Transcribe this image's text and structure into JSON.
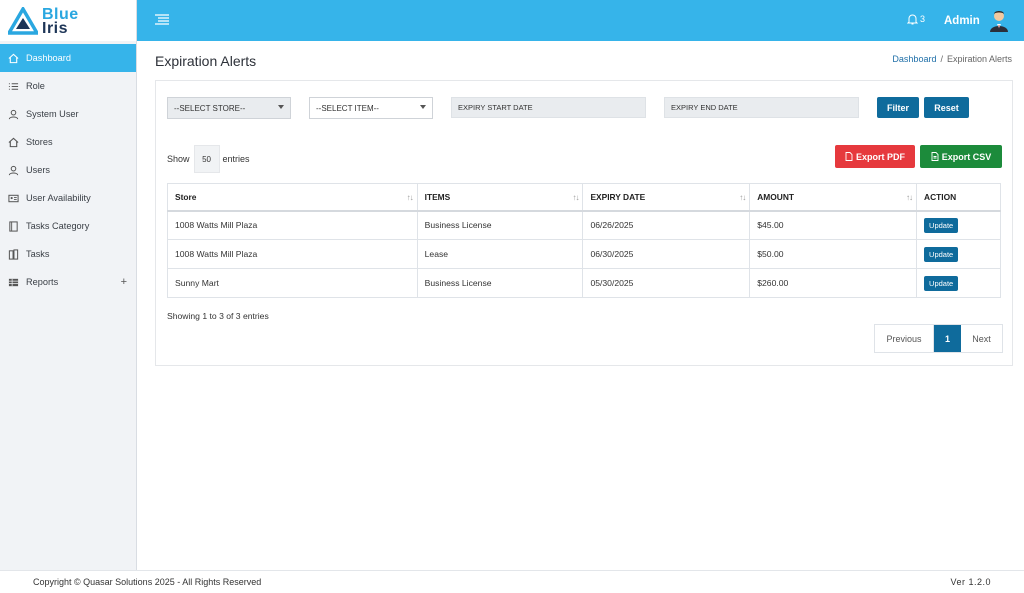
{
  "brand": {
    "line1": "Blue",
    "line2": "Iris"
  },
  "sidebar": {
    "items": [
      {
        "label": "Dashboard",
        "icon": "home-icon"
      },
      {
        "label": "Role",
        "icon": "list-icon"
      },
      {
        "label": "System User",
        "icon": "user-icon"
      },
      {
        "label": "Stores",
        "icon": "home-icon"
      },
      {
        "label": "Users",
        "icon": "user-icon"
      },
      {
        "label": "User Availability",
        "icon": "id-card-icon"
      },
      {
        "label": "Tasks Category",
        "icon": "book-icon"
      },
      {
        "label": "Tasks",
        "icon": "books-icon"
      },
      {
        "label": "Reports",
        "icon": "table-icon",
        "expand": "+"
      }
    ]
  },
  "header": {
    "notification_count": "3",
    "user_name": "Admin"
  },
  "page": {
    "title": "Expiration Alerts",
    "breadcrumb": {
      "home": "Dashboard",
      "separator": "/",
      "current": "Expiration Alerts"
    }
  },
  "filters": {
    "store_select": "--SELECT STORE--",
    "item_select": "--SELECT ITEM--",
    "start_date_placeholder": "EXPIRY START DATE",
    "end_date_placeholder": "EXPIRY END DATE",
    "filter_label": "Filter",
    "reset_label": "Reset"
  },
  "export": {
    "pdf_label": "Export PDF",
    "csv_label": "Export CSV"
  },
  "entries": {
    "show_label": "Show",
    "value": "50",
    "suffix": "entries"
  },
  "table": {
    "headers": [
      "Store",
      "ITEMS",
      "EXPIRY DATE",
      "AMOUNT",
      "ACTION"
    ],
    "rows": [
      {
        "store": "1008 Watts Mill Plaza",
        "item": "Business License",
        "date": "06/26/2025",
        "amount": "$45.00",
        "action": "Update"
      },
      {
        "store": "1008 Watts Mill Plaza",
        "item": "Lease",
        "date": "06/30/2025",
        "amount": "$50.00",
        "action": "Update"
      },
      {
        "store": "Sunny Mart",
        "item": "Business License",
        "date": "05/30/2025",
        "amount": "$260.00",
        "action": "Update"
      }
    ]
  },
  "summary": "Showing 1 to 3 of 3 entries",
  "pagination": {
    "previous": "Previous",
    "current": "1",
    "next": "Next"
  },
  "footer": {
    "copyright": "Copyright © Quasar Solutions 2025 - All Rights Reserved",
    "version": "Ver 1.2.0"
  },
  "colors": {
    "header_bg": "#36b4ea",
    "primary_button": "#0f6b9c",
    "pdf_button": "#e6393d",
    "csv_button": "#1c8b3b"
  }
}
